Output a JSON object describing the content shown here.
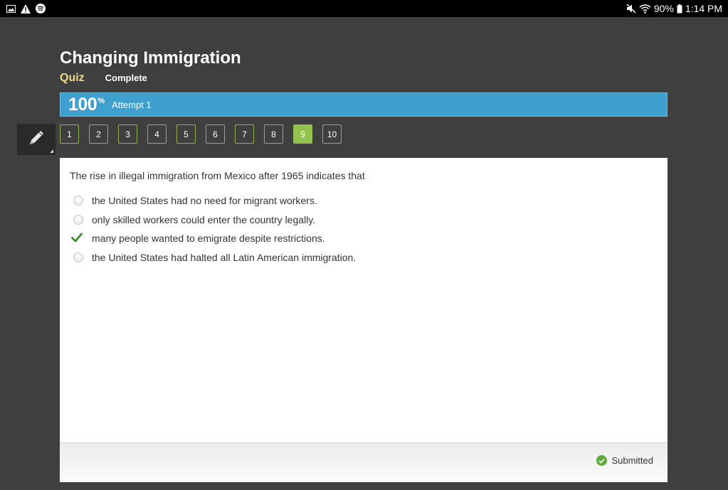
{
  "status_bar": {
    "left_icons": [
      "image-icon",
      "warning-icon",
      "spotify-icon"
    ],
    "right_icons": [
      "mute-icon",
      "wifi-icon",
      "battery-icon"
    ],
    "battery": "90%",
    "time": "1:14 PM"
  },
  "header": {
    "title": "Changing Immigration",
    "type_label": "Quiz",
    "status": "Complete"
  },
  "score": {
    "value": "100",
    "unit": "%",
    "attempt": "Attempt 1"
  },
  "question_nav": {
    "items": [
      "1",
      "2",
      "3",
      "4",
      "5",
      "6",
      "7",
      "8",
      "9",
      "10"
    ],
    "active": "9"
  },
  "question": {
    "text": "The rise in illegal immigration from Mexico after 1965 indicates that",
    "options": [
      {
        "text": "the United States had no need for migrant workers.",
        "selected": false
      },
      {
        "text": "only skilled workers could enter the country legally.",
        "selected": false
      },
      {
        "text": "many people wanted to emigrate despite restrictions.",
        "selected": true
      },
      {
        "text": "the United States had halted all Latin American immigration.",
        "selected": false
      }
    ]
  },
  "footer": {
    "submitted_label": "Submitted"
  },
  "colors": {
    "score_bar": "#3fa0cf",
    "active_question": "#93c24e",
    "quiz_label": "#f2d98b",
    "correct_check": "#3a8a2a"
  }
}
